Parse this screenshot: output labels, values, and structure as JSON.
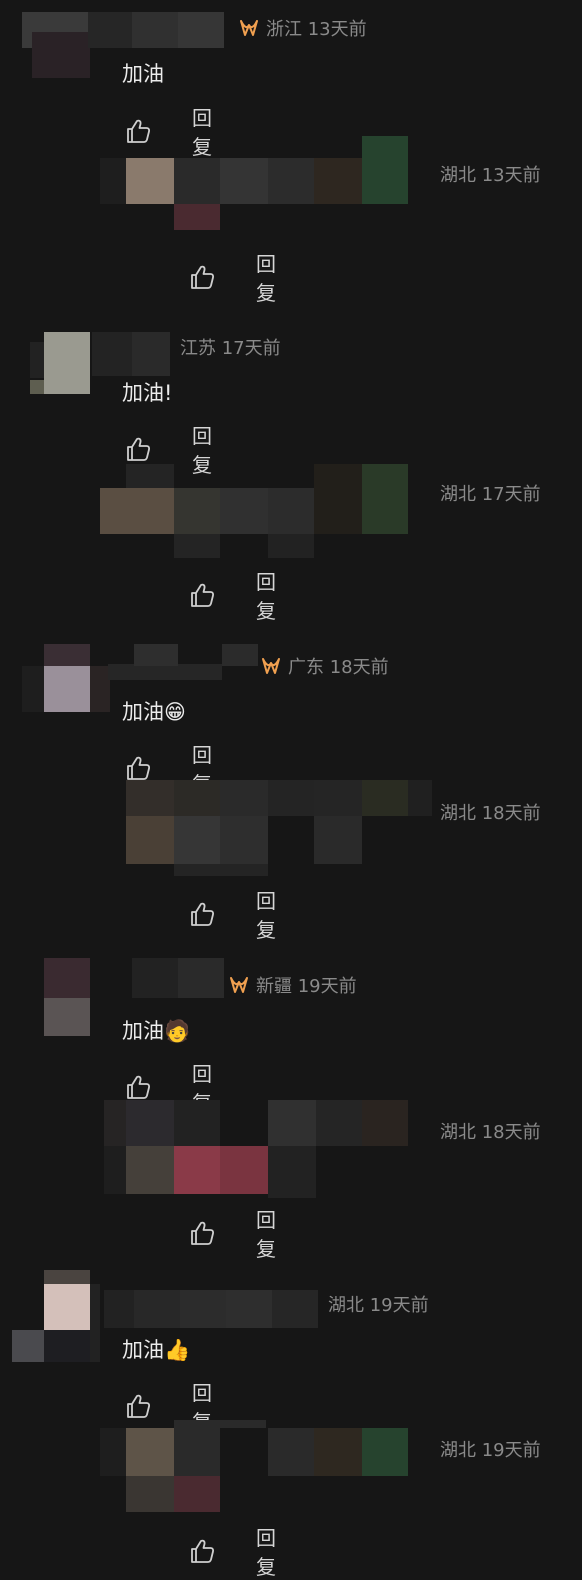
{
  "comments": [
    {
      "meta": "浙江 13天前",
      "text": "加油",
      "has_badge": true,
      "reply": {
        "meta": "湖北 13天前"
      }
    },
    {
      "meta": "江苏 17天前",
      "text": "加油!",
      "has_badge": false,
      "reply": {
        "meta": "湖北 17天前"
      }
    },
    {
      "meta": "广东 18天前",
      "text": "加油😁",
      "has_badge": true,
      "reply": {
        "meta": "湖北 18天前"
      }
    },
    {
      "meta": "新疆 19天前",
      "text": "加油🧑",
      "has_badge": true,
      "reply": {
        "meta": "湖北 18天前"
      }
    },
    {
      "meta": "湖北 19天前",
      "text": "加油👍",
      "has_badge": false,
      "reply": {
        "meta": "湖北 19天前"
      }
    }
  ],
  "actions": {
    "like_icon": "thumbs-up-icon",
    "reply_label": "回复"
  },
  "colors": {
    "background": "#161616",
    "badge": "#f0a050",
    "meta_text": "#8a8a8a"
  }
}
